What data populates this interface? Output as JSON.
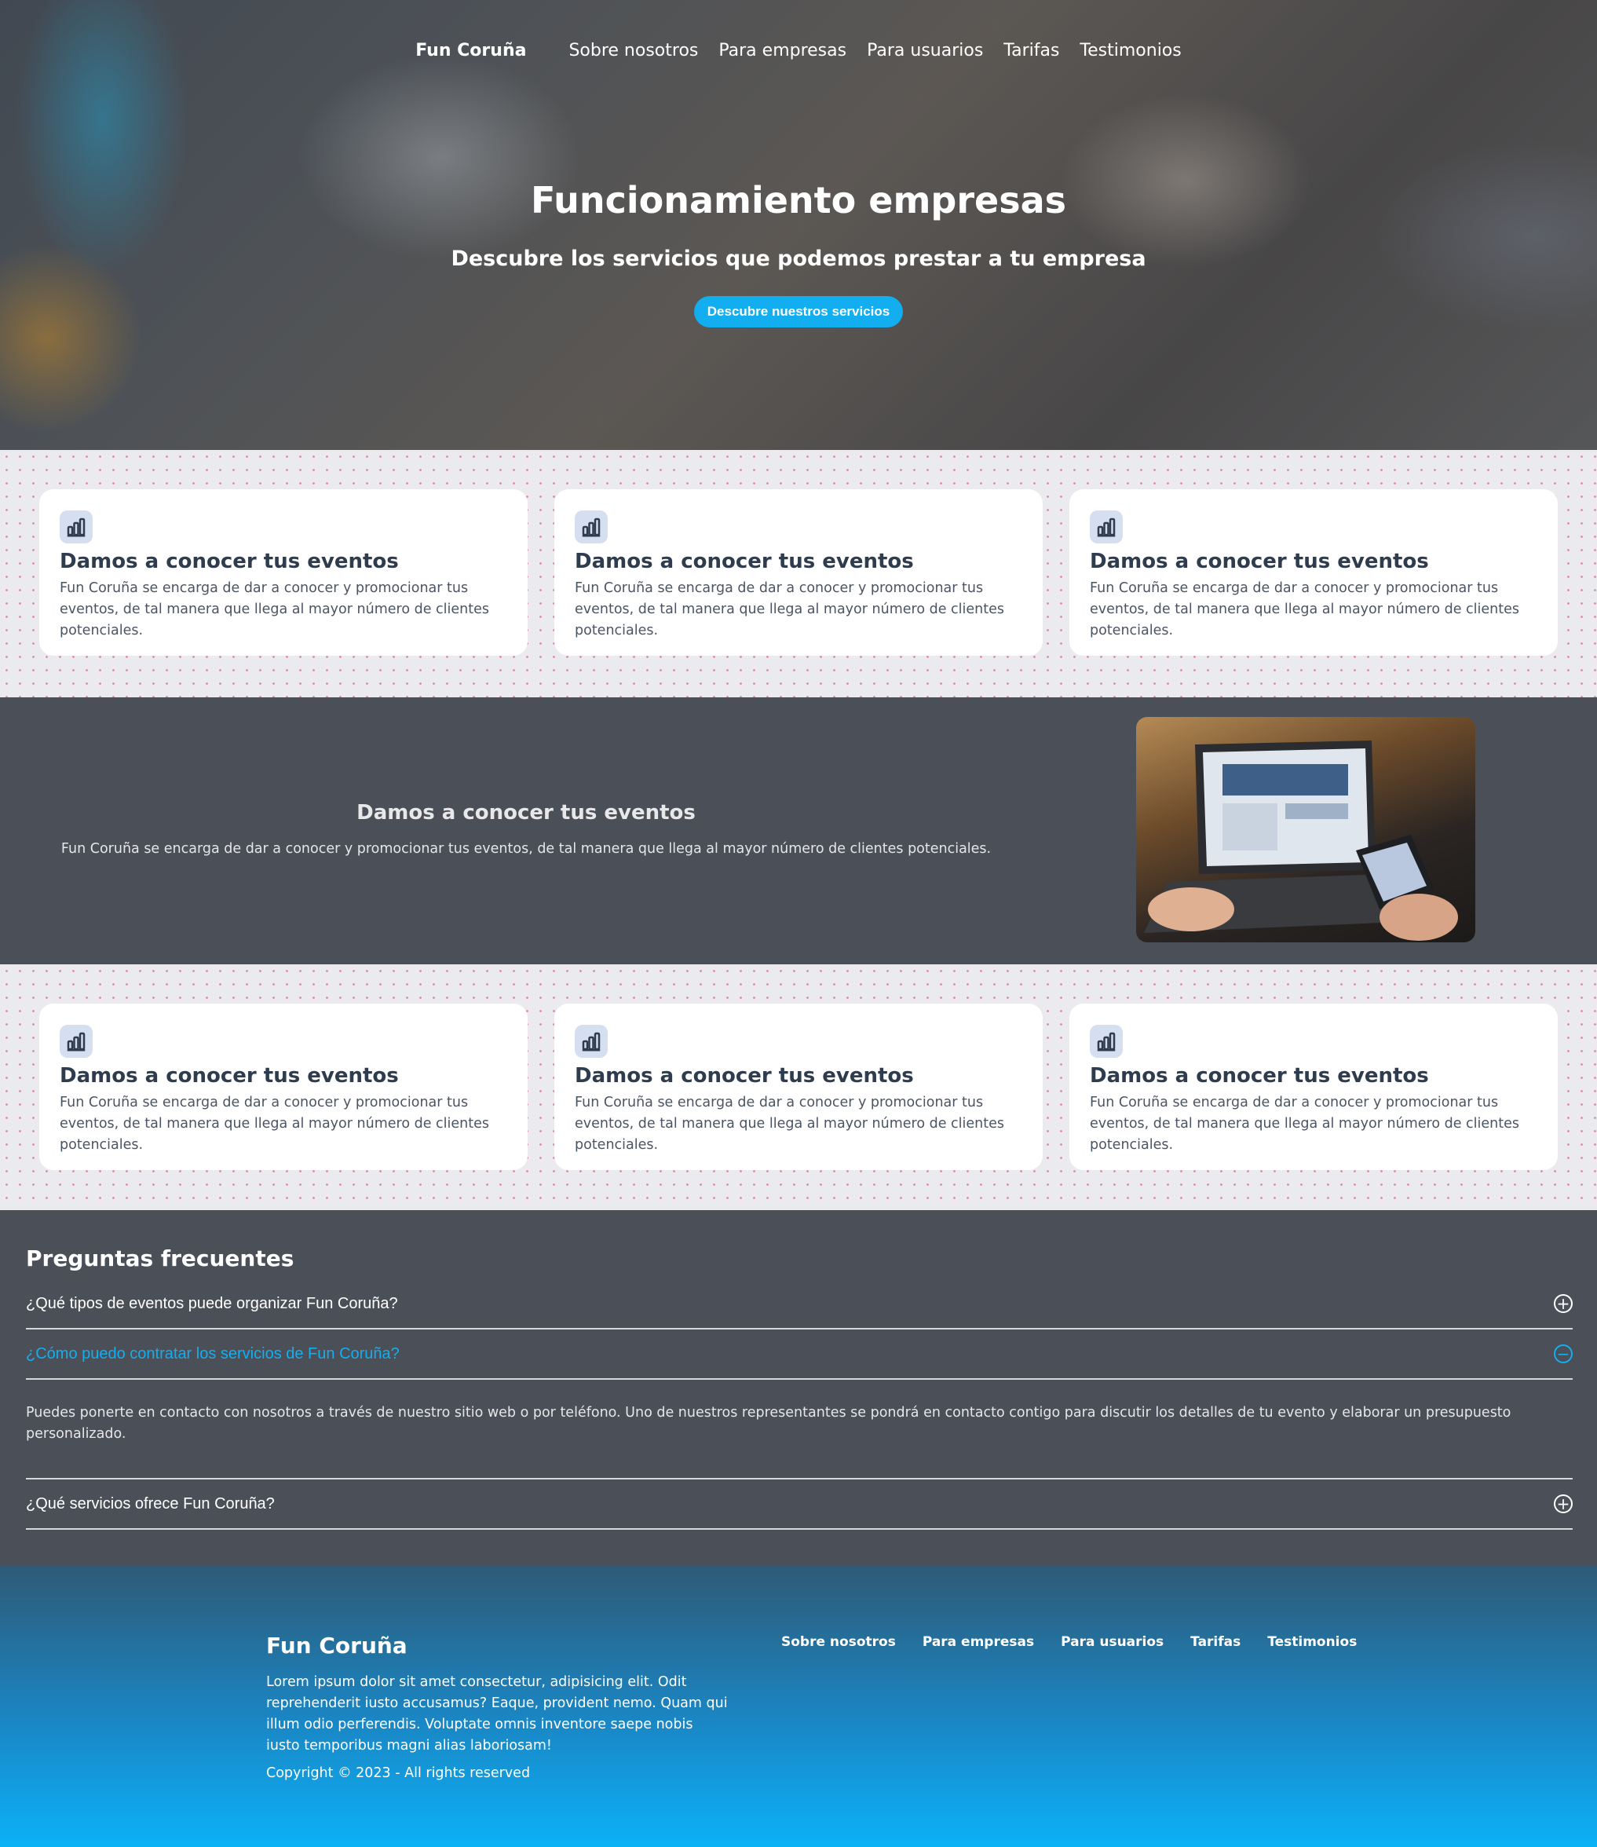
{
  "nav": {
    "brand": "Fun Coruña",
    "links": [
      "Sobre nosotros",
      "Para empresas",
      "Para usuarios",
      "Tarifas",
      "Testimonios"
    ]
  },
  "hero": {
    "title": "Funcionamiento empresas",
    "subtitle": "Descubre los servicios que podemos prestar a tu empresa",
    "cta": "Descubre nuestros servicios"
  },
  "cards_top": [
    {
      "icon": "bar-chart-icon",
      "title": "Damos a conocer tus eventos",
      "text": "Fun Coruña se encarga de dar a conocer y promocionar tus eventos, de tal manera que llega al mayor número de clientes potenciales."
    },
    {
      "icon": "bar-chart-icon",
      "title": "Damos a conocer tus eventos",
      "text": "Fun Coruña se encarga de dar a conocer y promocionar tus eventos, de tal manera que llega al mayor número de clientes potenciales."
    },
    {
      "icon": "bar-chart-icon",
      "title": "Damos a conocer tus eventos",
      "text": "Fun Coruña se encarga de dar a conocer y promocionar tus eventos, de tal manera que llega al mayor número de clientes potenciales."
    }
  ],
  "feature": {
    "title": "Damos a conocer tus eventos",
    "text": "Fun Coruña se encarga de dar a conocer y promocionar tus eventos, de tal manera que llega al mayor número de clientes potenciales."
  },
  "cards_bottom": [
    {
      "icon": "bar-chart-icon",
      "title": "Damos a conocer tus eventos",
      "text": "Fun Coruña se encarga de dar a conocer y promocionar tus eventos, de tal manera que llega al mayor número de clientes potenciales."
    },
    {
      "icon": "bar-chart-icon",
      "title": "Damos a conocer tus eventos",
      "text": "Fun Coruña se encarga de dar a conocer y promocionar tus eventos, de tal manera que llega al mayor número de clientes potenciales."
    },
    {
      "icon": "bar-chart-icon",
      "title": "Damos a conocer tus eventos",
      "text": "Fun Coruña se encarga de dar a conocer y promocionar tus eventos, de tal manera que llega al mayor número de clientes potenciales."
    }
  ],
  "faq": {
    "title": "Preguntas frecuentes",
    "items": [
      {
        "question": "¿Qué tipos de eventos puede organizar Fun Coruña?",
        "expanded": false
      },
      {
        "question": "¿Cómo puedo contratar los servicios de Fun Coruña?",
        "expanded": true,
        "answer": "Puedes ponerte en contacto con nosotros a través de nuestro sitio web o por teléfono. Uno de nuestros representantes se pondrá en contacto contigo para discutir los detalles de tu evento y elaborar un presupuesto personalizado."
      },
      {
        "question": "¿Qué servicios ofrece Fun Coruña?",
        "expanded": false
      }
    ],
    "toggle_open": "−",
    "toggle_closed": "+"
  },
  "footer": {
    "brand": "Fun Coruña",
    "text": "Lorem ipsum dolor sit amet consectetur, adipisicing elit. Odit reprehenderit iusto accusamus? Eaque, provident nemo. Quam qui illum odio perferendis. Voluptate omnis inventore saepe nobis iusto temporibus magni alias laboriosam!",
    "copyright": "Copyright © 2023 - All rights reserved",
    "links": [
      "Sobre nosotros",
      "Para empresas",
      "Para usuarios",
      "Tarifas",
      "Testimonios"
    ]
  },
  "colors": {
    "accent": "#12aef0",
    "dark_bg": "#4b4f58",
    "card_title": "#2f3c4d"
  }
}
